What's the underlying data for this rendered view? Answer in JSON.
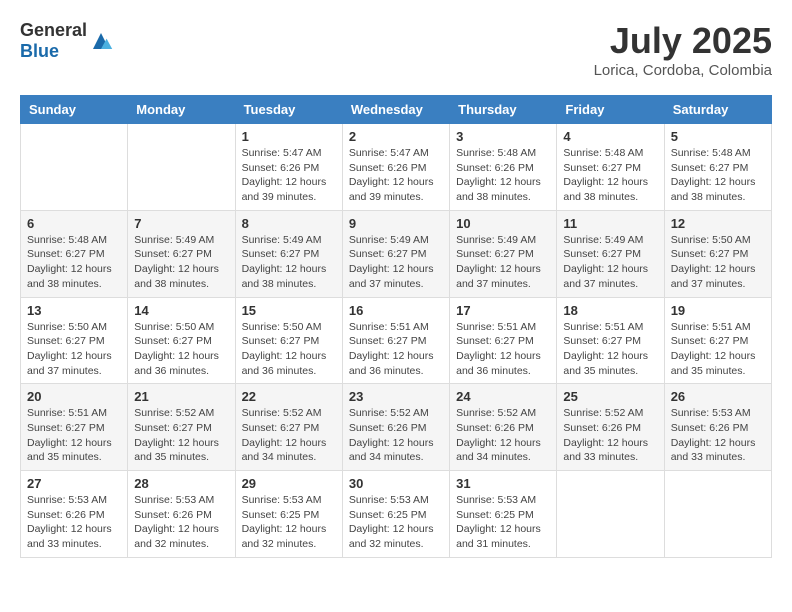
{
  "header": {
    "logo_general": "General",
    "logo_blue": "Blue",
    "month": "July 2025",
    "location": "Lorica, Cordoba, Colombia"
  },
  "days_of_week": [
    "Sunday",
    "Monday",
    "Tuesday",
    "Wednesday",
    "Thursday",
    "Friday",
    "Saturday"
  ],
  "weeks": [
    [
      {
        "day": "",
        "info": ""
      },
      {
        "day": "",
        "info": ""
      },
      {
        "day": "1",
        "info": "Sunrise: 5:47 AM\nSunset: 6:26 PM\nDaylight: 12 hours and 39 minutes."
      },
      {
        "day": "2",
        "info": "Sunrise: 5:47 AM\nSunset: 6:26 PM\nDaylight: 12 hours and 39 minutes."
      },
      {
        "day": "3",
        "info": "Sunrise: 5:48 AM\nSunset: 6:26 PM\nDaylight: 12 hours and 38 minutes."
      },
      {
        "day": "4",
        "info": "Sunrise: 5:48 AM\nSunset: 6:27 PM\nDaylight: 12 hours and 38 minutes."
      },
      {
        "day": "5",
        "info": "Sunrise: 5:48 AM\nSunset: 6:27 PM\nDaylight: 12 hours and 38 minutes."
      }
    ],
    [
      {
        "day": "6",
        "info": "Sunrise: 5:48 AM\nSunset: 6:27 PM\nDaylight: 12 hours and 38 minutes."
      },
      {
        "day": "7",
        "info": "Sunrise: 5:49 AM\nSunset: 6:27 PM\nDaylight: 12 hours and 38 minutes."
      },
      {
        "day": "8",
        "info": "Sunrise: 5:49 AM\nSunset: 6:27 PM\nDaylight: 12 hours and 38 minutes."
      },
      {
        "day": "9",
        "info": "Sunrise: 5:49 AM\nSunset: 6:27 PM\nDaylight: 12 hours and 37 minutes."
      },
      {
        "day": "10",
        "info": "Sunrise: 5:49 AM\nSunset: 6:27 PM\nDaylight: 12 hours and 37 minutes."
      },
      {
        "day": "11",
        "info": "Sunrise: 5:49 AM\nSunset: 6:27 PM\nDaylight: 12 hours and 37 minutes."
      },
      {
        "day": "12",
        "info": "Sunrise: 5:50 AM\nSunset: 6:27 PM\nDaylight: 12 hours and 37 minutes."
      }
    ],
    [
      {
        "day": "13",
        "info": "Sunrise: 5:50 AM\nSunset: 6:27 PM\nDaylight: 12 hours and 37 minutes."
      },
      {
        "day": "14",
        "info": "Sunrise: 5:50 AM\nSunset: 6:27 PM\nDaylight: 12 hours and 36 minutes."
      },
      {
        "day": "15",
        "info": "Sunrise: 5:50 AM\nSunset: 6:27 PM\nDaylight: 12 hours and 36 minutes."
      },
      {
        "day": "16",
        "info": "Sunrise: 5:51 AM\nSunset: 6:27 PM\nDaylight: 12 hours and 36 minutes."
      },
      {
        "day": "17",
        "info": "Sunrise: 5:51 AM\nSunset: 6:27 PM\nDaylight: 12 hours and 36 minutes."
      },
      {
        "day": "18",
        "info": "Sunrise: 5:51 AM\nSunset: 6:27 PM\nDaylight: 12 hours and 35 minutes."
      },
      {
        "day": "19",
        "info": "Sunrise: 5:51 AM\nSunset: 6:27 PM\nDaylight: 12 hours and 35 minutes."
      }
    ],
    [
      {
        "day": "20",
        "info": "Sunrise: 5:51 AM\nSunset: 6:27 PM\nDaylight: 12 hours and 35 minutes."
      },
      {
        "day": "21",
        "info": "Sunrise: 5:52 AM\nSunset: 6:27 PM\nDaylight: 12 hours and 35 minutes."
      },
      {
        "day": "22",
        "info": "Sunrise: 5:52 AM\nSunset: 6:27 PM\nDaylight: 12 hours and 34 minutes."
      },
      {
        "day": "23",
        "info": "Sunrise: 5:52 AM\nSunset: 6:26 PM\nDaylight: 12 hours and 34 minutes."
      },
      {
        "day": "24",
        "info": "Sunrise: 5:52 AM\nSunset: 6:26 PM\nDaylight: 12 hours and 34 minutes."
      },
      {
        "day": "25",
        "info": "Sunrise: 5:52 AM\nSunset: 6:26 PM\nDaylight: 12 hours and 33 minutes."
      },
      {
        "day": "26",
        "info": "Sunrise: 5:53 AM\nSunset: 6:26 PM\nDaylight: 12 hours and 33 minutes."
      }
    ],
    [
      {
        "day": "27",
        "info": "Sunrise: 5:53 AM\nSunset: 6:26 PM\nDaylight: 12 hours and 33 minutes."
      },
      {
        "day": "28",
        "info": "Sunrise: 5:53 AM\nSunset: 6:26 PM\nDaylight: 12 hours and 32 minutes."
      },
      {
        "day": "29",
        "info": "Sunrise: 5:53 AM\nSunset: 6:25 PM\nDaylight: 12 hours and 32 minutes."
      },
      {
        "day": "30",
        "info": "Sunrise: 5:53 AM\nSunset: 6:25 PM\nDaylight: 12 hours and 32 minutes."
      },
      {
        "day": "31",
        "info": "Sunrise: 5:53 AM\nSunset: 6:25 PM\nDaylight: 12 hours and 31 minutes."
      },
      {
        "day": "",
        "info": ""
      },
      {
        "day": "",
        "info": ""
      }
    ]
  ]
}
